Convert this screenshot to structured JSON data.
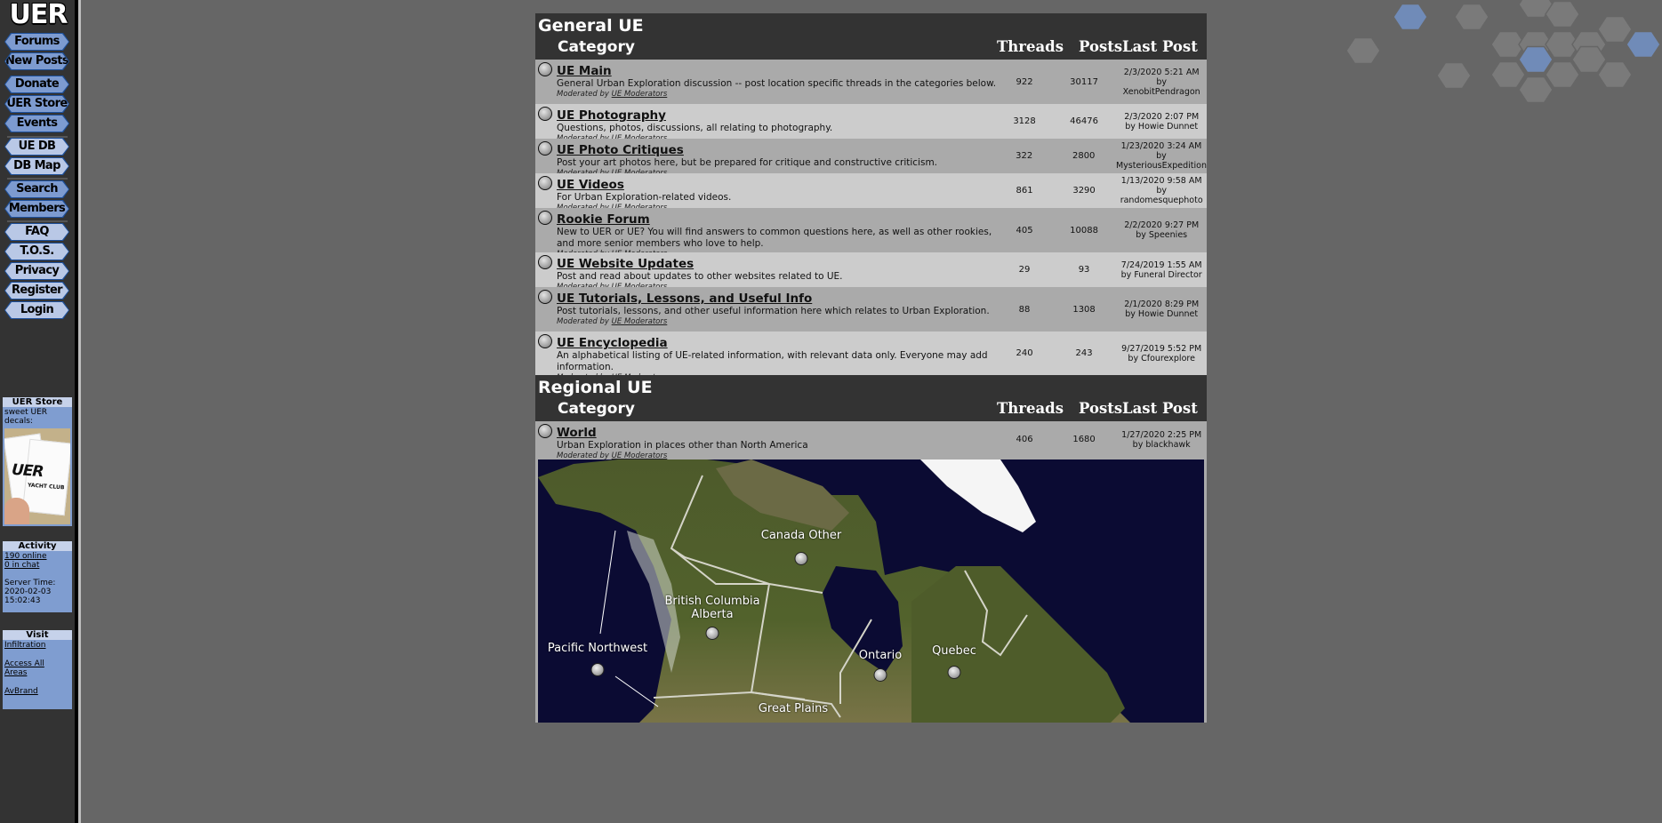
{
  "site": {
    "logo": "UER"
  },
  "sidebar": {
    "nav": [
      {
        "label": "Forums",
        "style": "dark"
      },
      {
        "label": "New Posts",
        "style": "dark"
      },
      {
        "label": "Donate",
        "style": "dark"
      },
      {
        "label": "UER Store",
        "style": "dark"
      },
      {
        "label": "Events",
        "style": "dark"
      },
      {
        "label": "UE DB",
        "style": "light"
      },
      {
        "label": "DB Map",
        "style": "light"
      },
      {
        "label": "Search",
        "style": "dark"
      },
      {
        "label": "Members",
        "style": "dark"
      },
      {
        "label": "FAQ",
        "style": "light"
      },
      {
        "label": "T.O.S.",
        "style": "light"
      },
      {
        "label": "Privacy",
        "style": "light"
      },
      {
        "label": "Register",
        "style": "light"
      },
      {
        "label": "Login",
        "style": "light"
      }
    ],
    "store_box": {
      "title": "UER Store",
      "text": "sweet UER decals:",
      "decal_print": "UER",
      "decal_subtext": "YACHT CLUB"
    },
    "activity_box": {
      "title": "Activity",
      "online": "190 online",
      "chat": "0 in chat",
      "server_time_label": "Server Time:",
      "server_date": "2020-02-03",
      "server_clock": "15:02:43"
    },
    "visit_box": {
      "title": "Visit",
      "links": [
        "Infiltration",
        "Access All Areas",
        "AvBrand"
      ]
    }
  },
  "sections": [
    {
      "title": "General UE",
      "columns": {
        "category": "Category",
        "threads": "Threads",
        "posts": "Posts",
        "last_post": "Last Post"
      },
      "forums": [
        {
          "name": "UE Main",
          "description": "General Urban Exploration discussion -- post location specific threads in the categories below.",
          "moderated_label": "Moderated by",
          "moderators": "UE Moderators",
          "threads": "922",
          "posts": "30117",
          "last_post_date": "2/3/2020 5:21 AM",
          "last_post_by": "by XenobitPendragon"
        },
        {
          "name": "UE Photography",
          "description": "Questions, photos, discussions, all relating to photography.",
          "moderated_label": "Moderated by",
          "moderators": "UE Moderators",
          "threads": "3128",
          "posts": "46476",
          "last_post_date": "2/3/2020 2:07 PM",
          "last_post_by": "by Howie Dunnet"
        },
        {
          "name": "UE Photo Critiques",
          "description": "Post your art photos here, but be prepared for critique and constructive criticism.",
          "moderated_label": "Moderated by",
          "moderators": "UE Moderators",
          "threads": "322",
          "posts": "2800",
          "last_post_date": "1/23/2020 3:24 AM",
          "last_post_by": "by MysteriousExpedition"
        },
        {
          "name": "UE Videos",
          "description": "For Urban Exploration-related videos.",
          "moderated_label": "Moderated by",
          "moderators": "UE Moderators",
          "threads": "861",
          "posts": "3290",
          "last_post_date": "1/13/2020 9:58 AM",
          "last_post_by": "by randomesquephoto"
        },
        {
          "name": "Rookie Forum",
          "description": "New to UER or UE? You will find answers to common questions here, as well as other rookies, and more senior members who love to help.",
          "moderated_label": "Moderated by",
          "moderators": "UE Moderators",
          "threads": "405",
          "posts": "10088",
          "last_post_date": "2/2/2020 9:27 PM",
          "last_post_by": "by Speenies"
        },
        {
          "name": "UE Website Updates",
          "description": "Post and read about updates to other websites related to UE.",
          "moderated_label": "Moderated by",
          "moderators": "UE Moderators",
          "threads": "29",
          "posts": "93",
          "last_post_date": "7/24/2019 1:55 AM",
          "last_post_by": "by Funeral Director"
        },
        {
          "name": "UE Tutorials, Lessons, and Useful Info",
          "description": "Post tutorials, lessons, and other useful information here which relates to Urban Exploration.",
          "moderated_label": "Moderated by",
          "moderators": "UE Moderators",
          "threads": "88",
          "posts": "1308",
          "last_post_date": "2/1/2020 8:29 PM",
          "last_post_by": "by Howie Dunnet"
        },
        {
          "name": "UE Encyclopedia",
          "description": "An alphabetical listing of UE-related information, with relevant data only. Everyone may add information.",
          "moderated_label": "Moderated by",
          "moderators": "UE Moderators",
          "threads": "240",
          "posts": "243",
          "last_post_date": "9/27/2019 5:52 PM",
          "last_post_by": "by Cfourexplore"
        }
      ]
    },
    {
      "title": "Regional UE",
      "columns": {
        "category": "Category",
        "threads": "Threads",
        "posts": "Posts",
        "last_post": "Last Post"
      },
      "forums": [
        {
          "name": "World",
          "description": "Urban Exploration in places other than North America",
          "moderated_label": "Moderated by",
          "moderators": "UE Moderators",
          "threads": "406",
          "posts": "1680",
          "last_post_date": "1/27/2020 2:25 PM",
          "last_post_by": "by blackhawk"
        }
      ]
    }
  ],
  "region_map": {
    "regions": [
      "Canada Other",
      "British Columbia\nAlberta",
      "Pacific Northwest",
      "Ontario",
      "Quebec",
      "Great Plains"
    ]
  },
  "colors": {
    "page_bg": "#666666",
    "sidebar_bg": "#333333",
    "header_bg": "#333333",
    "row_dark": "#aaaaaa",
    "row_light": "#cccccc",
    "accent_blue": "#7d9bd0",
    "ocean": "#0b0b33"
  }
}
